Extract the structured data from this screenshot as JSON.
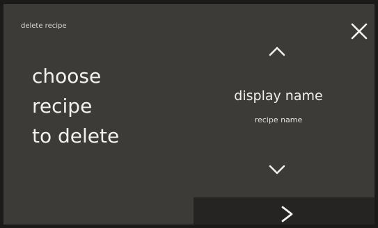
{
  "header": {
    "title": "delete recipe",
    "close_icon": "close-icon"
  },
  "prompt": {
    "lines": [
      "choose",
      "recipe",
      "to delete"
    ]
  },
  "selector": {
    "up_icon": "chevron-up-icon",
    "display_name": "display name",
    "recipe_name": "recipe name",
    "down_icon": "chevron-down-icon"
  },
  "footer": {
    "next_icon": "chevron-right-icon"
  },
  "colors": {
    "panel": "#3d3b38",
    "footer": "#262422",
    "text": "#f2f0ec"
  }
}
